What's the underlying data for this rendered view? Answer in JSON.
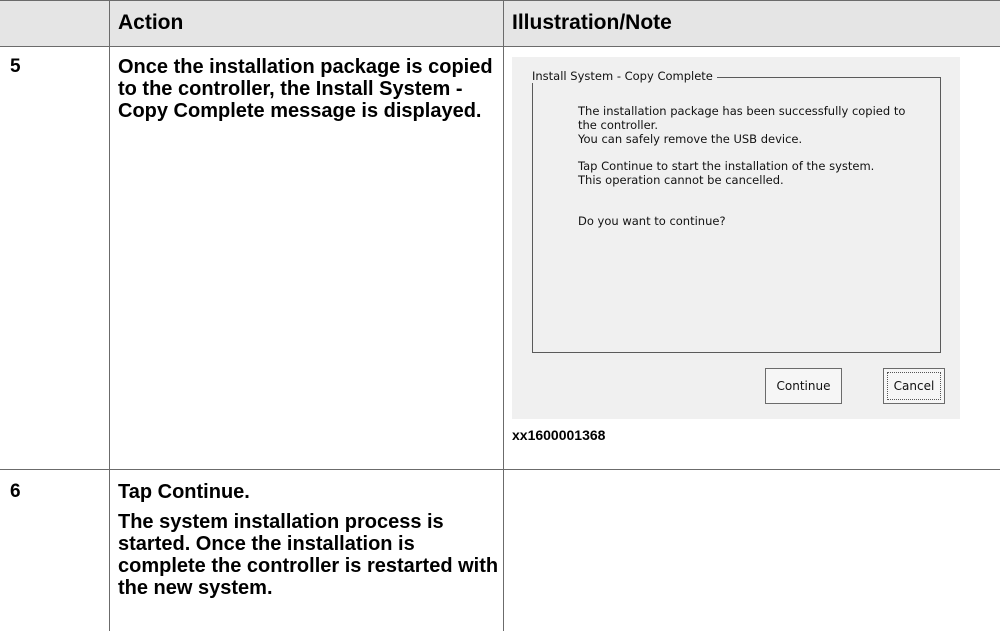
{
  "table": {
    "headers": {
      "step": "",
      "action": "Action",
      "note": "Illustration/Note"
    },
    "rows": [
      {
        "step": "5",
        "action_pre": "Once the installation package is copied to the controller, the ",
        "action_bold": "Install System - Copy Complete",
        "action_post": " message is displayed.",
        "image_id": "xx1600001368"
      },
      {
        "step": "6",
        "action_line1_pre": "Tap ",
        "action_line1_bold": "Continue",
        "action_line1_post": ".",
        "action_line2": "The system installation process is started. Once the installation is complete the controller is restarted with the new system."
      }
    ]
  },
  "dialog": {
    "group_title": "Install System - Copy Complete",
    "line1": "The installation package has been successfully copied to",
    "line2": "the controller.",
    "line3": "You can safely remove the USB device.",
    "line4": "Tap Continue to start the installation of the system.",
    "line5": "This operation cannot be cancelled.",
    "line6": "Do you want to continue?",
    "continue_label": "Continue",
    "cancel_label": "Cancel"
  }
}
